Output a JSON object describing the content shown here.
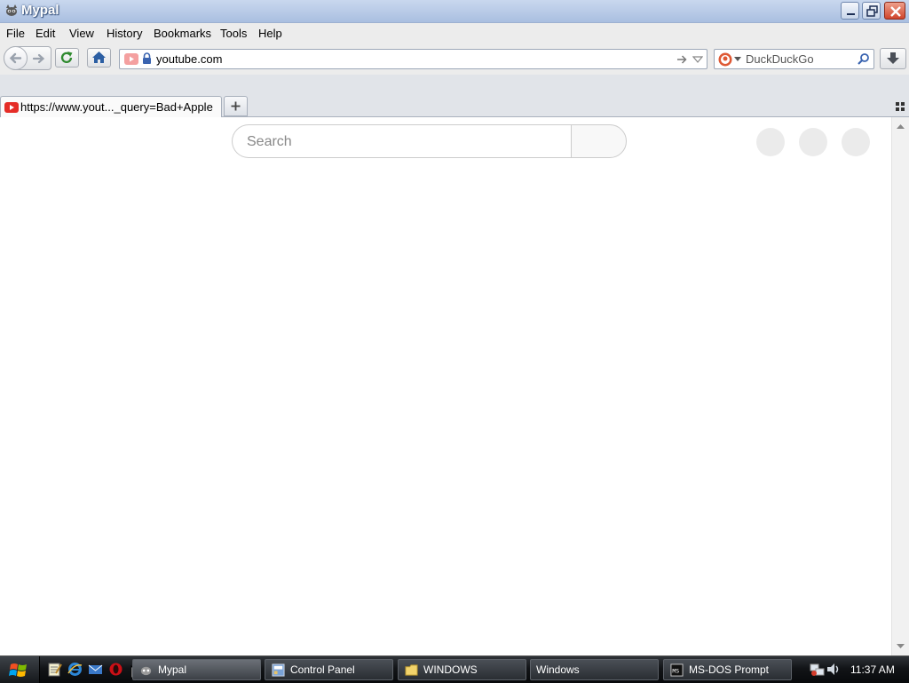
{
  "window": {
    "title": "Mypal"
  },
  "menu": {
    "file": "File",
    "edit": "Edit",
    "view": "View",
    "history": "History",
    "bookmarks": "Bookmarks",
    "tools": "Tools",
    "help": "Help"
  },
  "toolbar": {
    "url": "youtube.com",
    "search_engine": "DuckDuckGo"
  },
  "tabs": [
    {
      "title": "https://www.yout..._query=Bad+Apple"
    }
  ],
  "page": {
    "search_placeholder": "Search"
  },
  "taskbar": {
    "buttons": [
      {
        "label": "Mypal"
      },
      {
        "label": "Control Panel"
      },
      {
        "label": "WINDOWS"
      },
      {
        "label": "Windows"
      },
      {
        "label": "MS-DOS Prompt"
      }
    ],
    "clock": "11:37 AM"
  },
  "colors": {
    "titlebar": "#b6c9e6",
    "youtube_red": "#ff0000",
    "taskbar": "#121417"
  }
}
